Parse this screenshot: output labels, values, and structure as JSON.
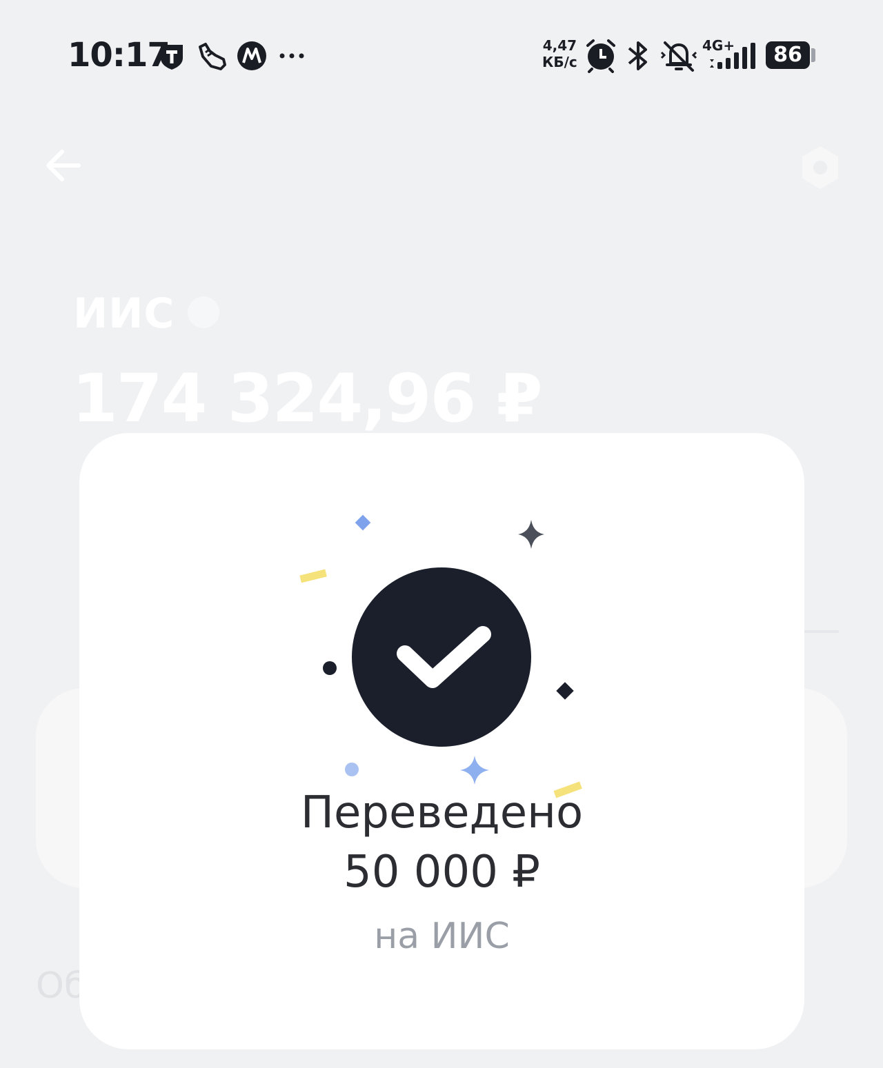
{
  "status_bar": {
    "time": "10:17",
    "net_speed_value": "4,47",
    "net_speed_unit": "КБ/с",
    "network_type": "4G+",
    "battery_level": "86",
    "notification_icons": [
      "t-shield-icon",
      "shoe-icon",
      "m-app-icon",
      "more-dots-icon"
    ],
    "system_icons": [
      "alarm-icon",
      "bluetooth-icon",
      "mute-bell-icon",
      "signal-icon",
      "battery-icon"
    ]
  },
  "background_screen": {
    "account_name": "ИИС",
    "balance": "174 324,96 ₽",
    "partial_text": "Об"
  },
  "dialog": {
    "title": "Переведено",
    "amount": "50 000 ₽",
    "destination": "на ИИС"
  },
  "colors": {
    "check_circle": "#1a1f2b",
    "confetti_blue": "#8fb0ef",
    "confetti_yellow": "#f5e27a",
    "dim_background": "#f0f1f3"
  }
}
